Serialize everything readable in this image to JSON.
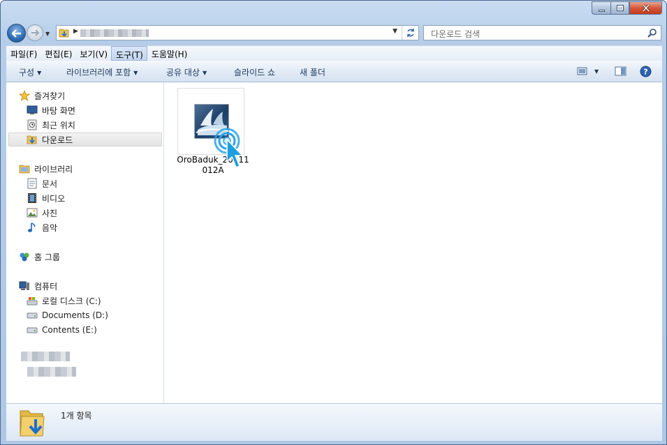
{
  "address": {
    "search_placeholder": "다운로드 검색"
  },
  "menu": {
    "items": [
      "파일(F)",
      "편집(E)",
      "보기(V)",
      "도구(T)",
      "도움말(H)"
    ],
    "active": "도구(T)"
  },
  "toolbar": {
    "organize": "구성",
    "include_library": "라이브러리에 포함",
    "share_with": "공유 대상",
    "slideshow": "슬라이드 쇼",
    "new_folder": "새 폴더"
  },
  "navigation": {
    "favorites": {
      "label": "즐겨찾기",
      "items": [
        "바탕 화면",
        "최근 위치",
        "다운로드"
      ],
      "selected": "다운로드"
    },
    "libraries": {
      "label": "라이브러리",
      "items": [
        "문서",
        "비디오",
        "사진",
        "음악"
      ]
    },
    "homegroup": {
      "label": "홈 그룹"
    },
    "computer": {
      "label": "컴퓨터",
      "items": [
        "로컬 디스크 (C:)",
        "Documents (D:)",
        "Contents (E:)"
      ]
    }
  },
  "files": [
    {
      "name_line1": "OroBaduk_20111",
      "name_line2": "012A"
    }
  ],
  "status": {
    "item_count": "1개 항목"
  },
  "colors": {
    "frame": "#b5cde9",
    "accent": "#2d6cb5",
    "cursor": "#1f9fe0"
  }
}
